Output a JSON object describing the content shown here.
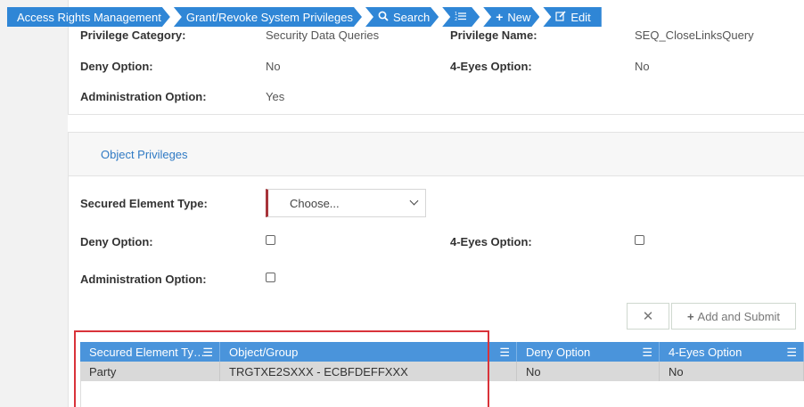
{
  "breadcrumb": [
    {
      "label": "Access Rights Management",
      "icon": ""
    },
    {
      "label": "Grant/Revoke System Privileges",
      "icon": ""
    },
    {
      "label": "Search",
      "icon": "search-icon"
    },
    {
      "label": "",
      "icon": "list-icon"
    },
    {
      "label": "New",
      "icon": "plus-icon"
    },
    {
      "label": "Edit",
      "icon": "edit-icon"
    }
  ],
  "details": {
    "privilege_category_label": "Privilege Category:",
    "privilege_category_value": "Security Data Queries",
    "privilege_name_label": "Privilege Name:",
    "privilege_name_value": "SEQ_CloseLinksQuery",
    "deny_option_label": "Deny Option:",
    "deny_option_value": "No",
    "four_eyes_label": "4-Eyes Option:",
    "four_eyes_value": "No",
    "admin_option_label": "Administration Option:",
    "admin_option_value": "Yes"
  },
  "object_privileges": {
    "section_title": "Object Privileges",
    "secured_element_type_label": "Secured Element Type:",
    "secured_element_type_value": "Choose...",
    "deny_option_label": "Deny Option:",
    "four_eyes_label": "4-Eyes Option:",
    "admin_option_label": "Administration Option:",
    "deny_checked": false,
    "four_eyes_checked": false,
    "admin_checked": false,
    "cancel_icon": "close-icon",
    "add_submit_label": "Add and Submit"
  },
  "grid": {
    "columns": [
      "Secured Element Ty…",
      "Object/Group",
      "Deny Option",
      "4-Eyes Option"
    ],
    "rows": [
      [
        "Party",
        "TRGTXE2SXXX - ECBFDEFFXXX",
        "No",
        "No"
      ]
    ],
    "header_color": "#4a94db",
    "row_color": "#d9d9d9"
  },
  "colors": {
    "accent": "#2f86d6",
    "link": "#2f7ac4",
    "required_marker": "#a7343a",
    "highlight_box": "#d9333a"
  }
}
